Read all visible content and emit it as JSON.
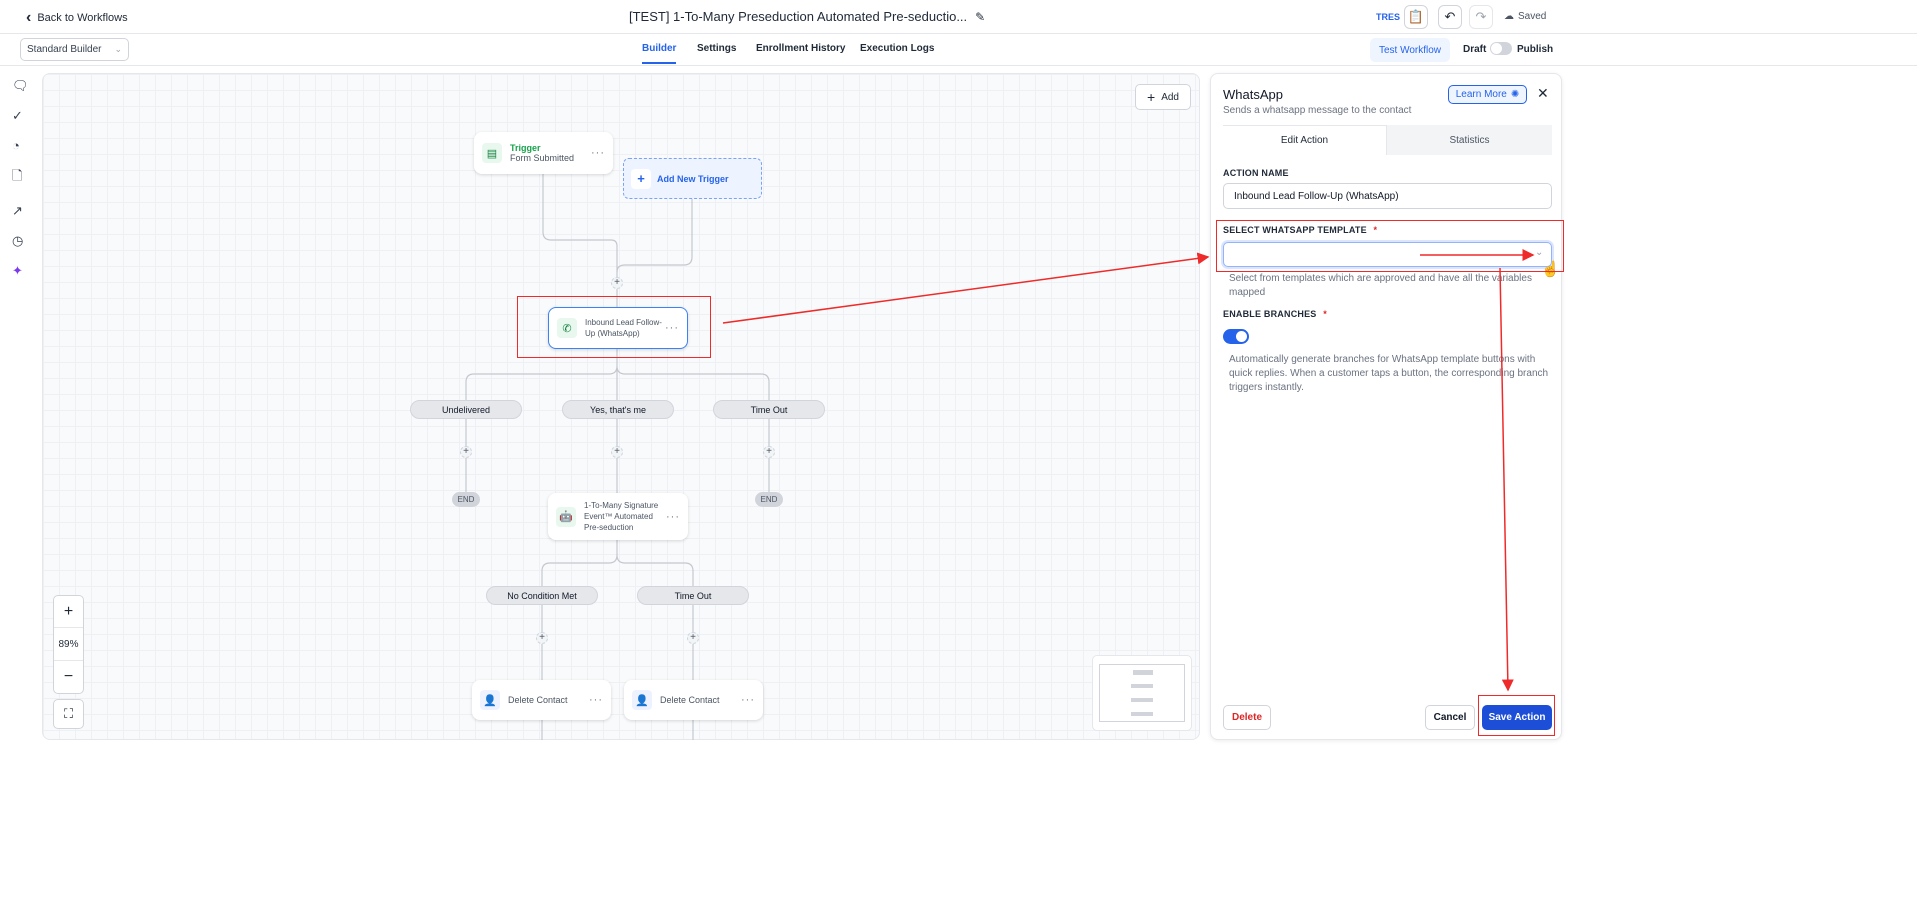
{
  "header": {
    "back_label": "Back to Workflows",
    "title": "[TEST] 1-To-Many Preseduction Automated Pre-seductio...",
    "user_badge": "TRES",
    "saved_label": "Saved"
  },
  "subbar": {
    "builder_select": "Standard Builder",
    "tabs": [
      {
        "label": "Builder",
        "active": true
      },
      {
        "label": "Settings"
      },
      {
        "label": "Enrollment History"
      },
      {
        "label": "Execution Logs"
      }
    ],
    "test_workflow": "Test Workflow",
    "draft_label": "Draft",
    "publish_label": "Publish",
    "published": false
  },
  "sidebar": {
    "icons": [
      "chat-icon",
      "check-circle-icon",
      "pie-chart-icon",
      "file-icon",
      "external-link-icon",
      "clock-icon",
      "sparkle-icon"
    ]
  },
  "canvas": {
    "add_label": "Add",
    "trigger": {
      "title": "Trigger",
      "subtitle": "Form Submitted"
    },
    "add_trigger": "Add New Trigger",
    "whatsapp_node": "Inbound Lead Follow-Up (WhatsApp)",
    "branches1": [
      "Undelivered",
      "Yes, that's me",
      "Time Out"
    ],
    "end_label": "END",
    "signature_node": "1-To-Many Signature Event™ Automated Pre-seduction",
    "branches2": [
      "No Condition Met",
      "Time Out"
    ],
    "delete_nodes": [
      "Delete Contact",
      "Delete Contact"
    ],
    "zoom_level": "89%"
  },
  "panel": {
    "title": "WhatsApp",
    "subtitle": "Sends a whatsapp message to the contact",
    "learn_more": "Learn More",
    "tabs": [
      "Edit Action",
      "Statistics"
    ],
    "action_name_label": "ACTION NAME",
    "action_name_value": "Inbound Lead Follow-Up (WhatsApp)",
    "template_label": "SELECT WHATSAPP TEMPLATE",
    "template_value": "",
    "template_help": "Select from templates which are approved and have all the variables mapped",
    "branches_label": "ENABLE BRANCHES",
    "branches_enabled": true,
    "branches_help": "Automatically generate branches for WhatsApp template buttons with quick replies. When a customer taps a button, the corresponding branch triggers instantly.",
    "required_mark": "*",
    "delete": "Delete",
    "cancel": "Cancel",
    "save": "Save Action"
  },
  "colors": {
    "accent": "#2563eb",
    "annotation": "#ef2a2a",
    "delete": "#dc2626"
  }
}
